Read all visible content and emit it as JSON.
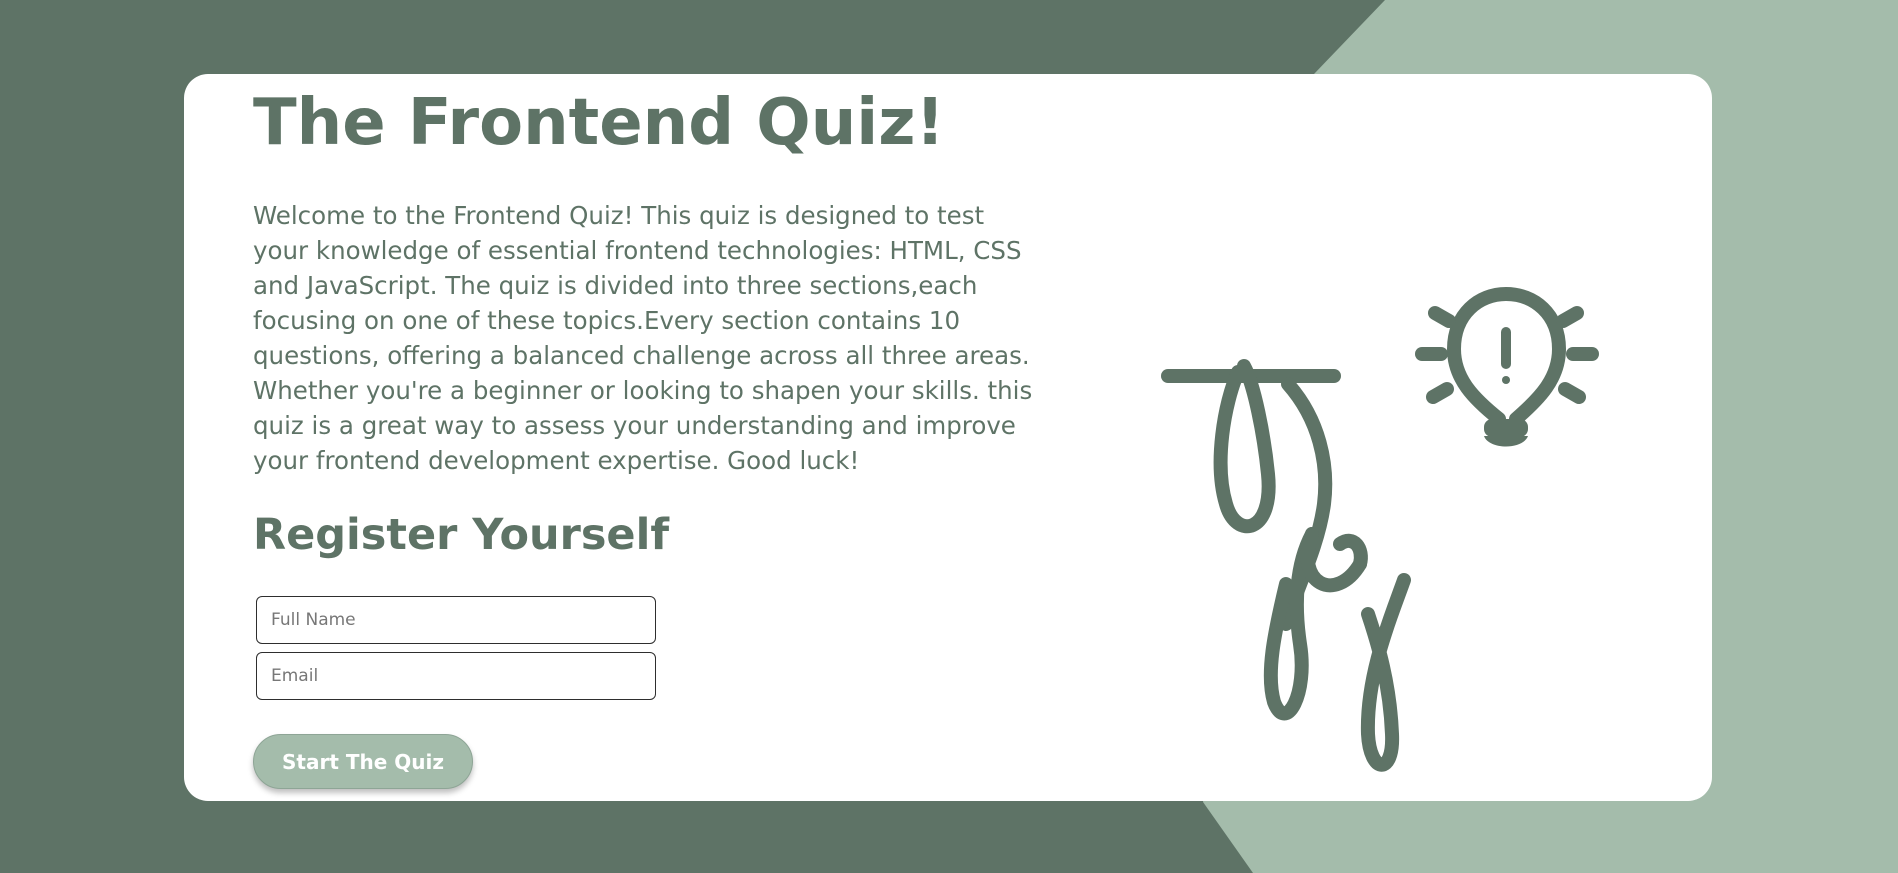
{
  "colors": {
    "primary": "#5e7366",
    "accent": "#a4bcab",
    "card": "#ffffff"
  },
  "main": {
    "title": "The Frontend Quiz!",
    "intro": "Welcome to the Frontend Quiz! This quiz is designed to test your knowledge of essential frontend technologies: HTML, CSS and JavaScript. The quiz is divided into three sections,each focusing on one of these topics.Every section contains 10 questions, offering a balanced challenge across all three areas. Whether you're a beginner or looking to shapen your skills. this quiz is a great way to assess your understanding and improve your frontend development expertise. Good luck!",
    "register_heading": "Register Yourself"
  },
  "form": {
    "name_placeholder": "Full Name",
    "email_placeholder": "Email",
    "start_label": "Start The Quiz"
  },
  "illustration": {
    "logo_icon": "tfq-monogram",
    "idea_icon": "lightbulb-icon"
  }
}
